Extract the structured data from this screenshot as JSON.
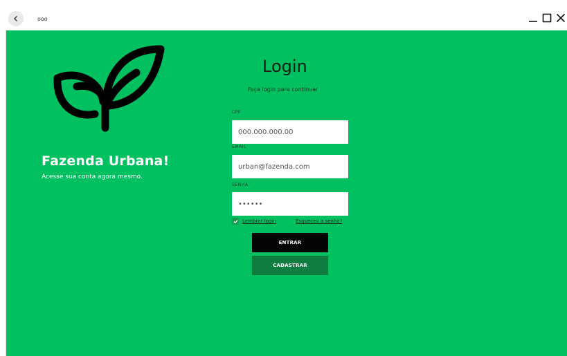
{
  "window": {
    "brand": "ooo",
    "controls": [
      "minimize",
      "maximize",
      "close"
    ]
  },
  "colors": {
    "panel": "#00c060",
    "enter_button": "#050505",
    "register_button": "#0f7d3f",
    "input_bg": "#ffffff"
  },
  "icons": {
    "back": "chevron-left-icon",
    "logo": "leaf-sprout-icon",
    "remember": "checkmark-icon"
  },
  "brand": {
    "title": "Fazenda Urbana!",
    "subtitle": "Acesse sua conta agora mesmo."
  },
  "login": {
    "title": "Login",
    "subtitle": "Faça login para continuar",
    "cpf": {
      "label": "CPF",
      "placeholder": "000.000.000.00"
    },
    "email": {
      "label": "EMAIL",
      "placeholder": "urban@fazenda.com"
    },
    "password": {
      "label": "SENHA",
      "placeholder": "••••••"
    },
    "remember_label": "Lembrar login",
    "remember_checked": true,
    "forgot_label": "Esqueceu a senha?",
    "enter_label": "ENTRAR",
    "register_label": "CADASTRAR"
  }
}
